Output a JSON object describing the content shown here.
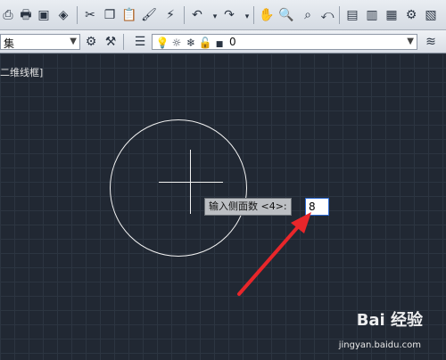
{
  "toolbar": {
    "row1_icons": [
      "print-icon",
      "print-preview-icon",
      "publish-icon",
      "match-properties-icon",
      "cut-icon",
      "copy-icon",
      "paste-icon",
      "paint-icon",
      "brush-icon",
      "undo-icon",
      "redo-icon",
      "pan-icon",
      "zoom-realtime-icon",
      "zoom-window-icon",
      "zoom-previous-icon",
      "properties-icon",
      "design-center-icon",
      "tool-palettes-icon",
      "sheet-set-icon",
      "markup-icon"
    ],
    "layer_combo_value": "集",
    "layer_state_value": "0"
  },
  "viewport": {
    "label": "二维线框]",
    "prompt_text": "输入侧面数 <4>:",
    "input_value": "8"
  },
  "watermark": {
    "brand": "Bai 经验",
    "url": "jingyan.baidu.com"
  },
  "colors": {
    "canvas_bg": "#212833",
    "grid": "#2c3541",
    "geometry": "#f2f2f2",
    "arrow": "#e8262a"
  }
}
